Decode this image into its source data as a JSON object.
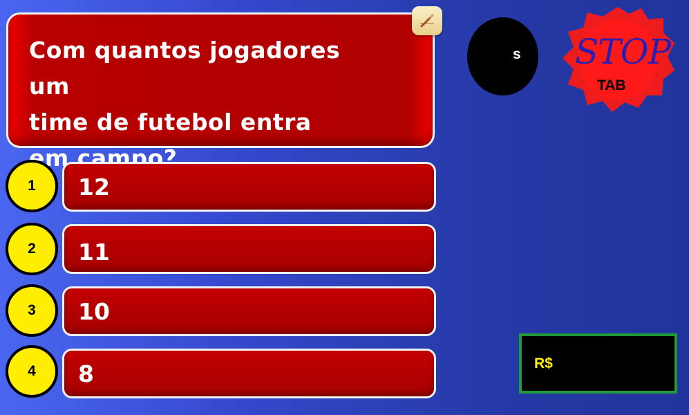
{
  "question": {
    "text": "Com quantos jogadores um\ntime de futebol entra\nem campo?"
  },
  "edit_button": {
    "icon": "pencil-icon"
  },
  "timer": {
    "unit": "s"
  },
  "stop_button": {
    "word": "STOP",
    "key": "TAB"
  },
  "options": [
    {
      "number": "1",
      "answer": "12"
    },
    {
      "number": "2",
      "answer": "11"
    },
    {
      "number": "3",
      "answer": "10"
    },
    {
      "number": "4",
      "answer": "8"
    }
  ],
  "prize": {
    "label": "R$"
  },
  "colors": {
    "background": "#3448cc",
    "answer_red": "#b00000",
    "number_yellow": "#ffee00",
    "prize_border": "#1f9a3a"
  }
}
